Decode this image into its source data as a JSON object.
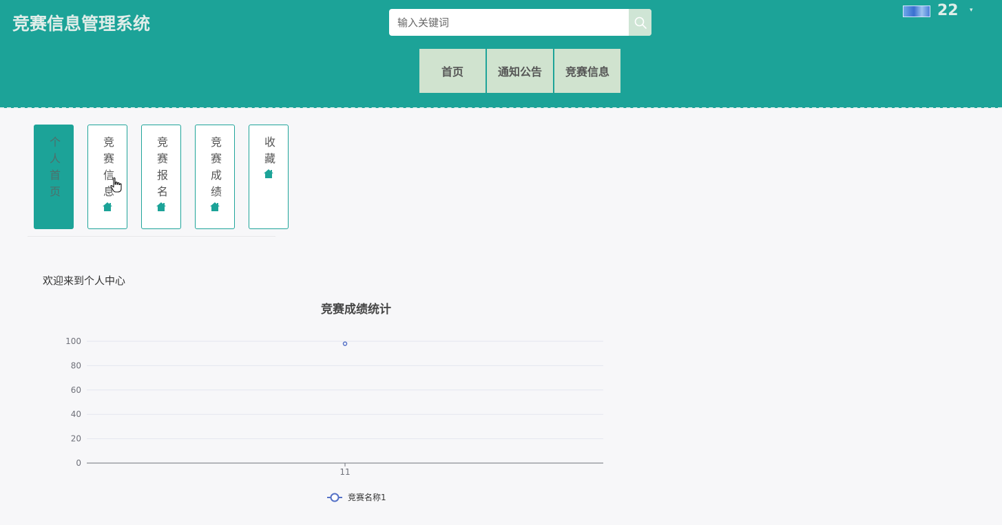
{
  "header": {
    "title": "竞赛信息管理系统",
    "search": {
      "placeholder": "输入关键词",
      "value": ""
    },
    "user": {
      "name": "22"
    },
    "nav": [
      "首页",
      "通知公告",
      "竞赛信息"
    ]
  },
  "colors": {
    "primary": "#1ca398",
    "nav_bg": "#d0e3cf",
    "series": "#5470c6"
  },
  "sidebar_tiles": [
    {
      "label": "个人首页",
      "active": true,
      "icon": ""
    },
    {
      "label": "竞赛信息",
      "active": false,
      "icon": "home-icon"
    },
    {
      "label": "竞赛报名",
      "active": false,
      "icon": "home-icon"
    },
    {
      "label": "竞赛成绩",
      "active": false,
      "icon": "home-icon"
    },
    {
      "label": "收藏",
      "active": false,
      "icon": "home-icon"
    }
  ],
  "welcome_text": "欢迎来到个人中心",
  "chart_data": {
    "type": "line",
    "title": "竞赛成绩统计",
    "categories": [
      "11"
    ],
    "series": [
      {
        "name": "竞赛名称1",
        "values": [
          98
        ]
      }
    ],
    "ylim": [
      0,
      100
    ],
    "yticks": [
      0,
      20,
      40,
      60,
      80,
      100
    ],
    "grid": true,
    "legend": "bottom-center"
  }
}
